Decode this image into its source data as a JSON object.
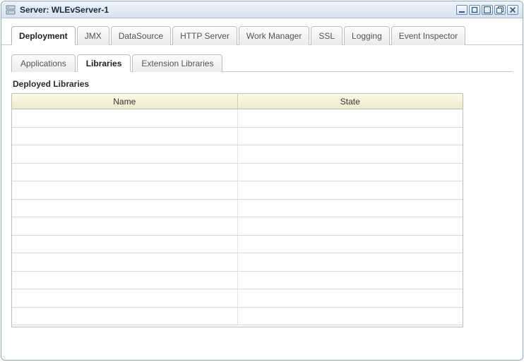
{
  "window": {
    "title": "Server: WLEvServer-1"
  },
  "topTabs": [
    {
      "label": "Deployment",
      "active": true
    },
    {
      "label": "JMX"
    },
    {
      "label": "DataSource"
    },
    {
      "label": "HTTP Server"
    },
    {
      "label": "Work Manager"
    },
    {
      "label": "SSL"
    },
    {
      "label": "Logging"
    },
    {
      "label": "Event Inspector"
    }
  ],
  "subTabs": [
    {
      "label": "Applications"
    },
    {
      "label": "Libraries",
      "active": true
    },
    {
      "label": "Extension Libraries"
    }
  ],
  "section": {
    "title": "Deployed Libraries"
  },
  "grid": {
    "columns": [
      "Name",
      "State"
    ],
    "rows": [
      {
        "name": "",
        "state": ""
      },
      {
        "name": "",
        "state": ""
      },
      {
        "name": "",
        "state": ""
      },
      {
        "name": "",
        "state": ""
      },
      {
        "name": "",
        "state": ""
      },
      {
        "name": "",
        "state": ""
      },
      {
        "name": "",
        "state": ""
      },
      {
        "name": "",
        "state": ""
      },
      {
        "name": "",
        "state": ""
      },
      {
        "name": "",
        "state": ""
      },
      {
        "name": "",
        "state": ""
      },
      {
        "name": "",
        "state": ""
      }
    ]
  }
}
